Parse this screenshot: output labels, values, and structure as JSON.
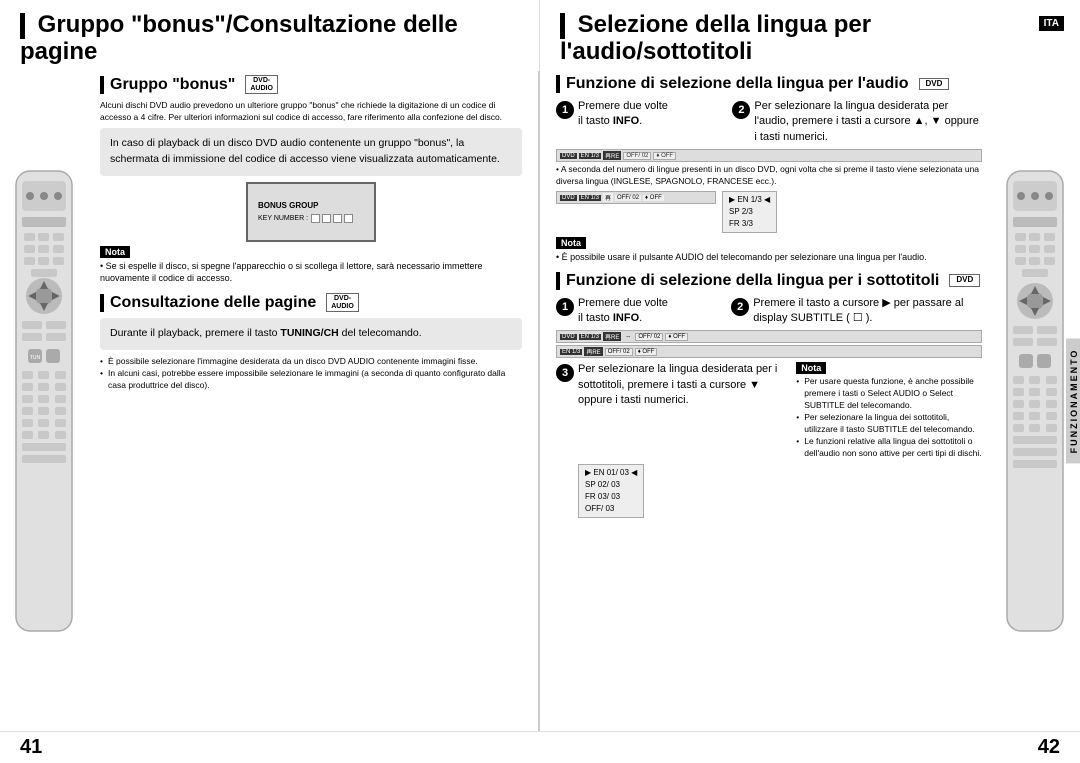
{
  "left_header": {
    "title": "Gruppo \"bonus\"/Consultazione delle pagine"
  },
  "right_header": {
    "title": "Selezione della lingua per l'audio/sottotitoli",
    "ita": "ITA"
  },
  "page_numbers": {
    "left": "41",
    "right": "42"
  },
  "left_page": {
    "section1": {
      "title": "Gruppo \"bonus\"",
      "dvd_label": "DVD-\nAUDIO",
      "intro_text": "Alcuni dischi DVD audio prevedono un ulteriore gruppo \"bonus\" che richiede la digitazione di un codice di accesso a 4 cifre. Per ulteriori informazioni sul codice di accesso, fare riferimento alla confezione del disco.",
      "gray_box": "In caso di playback di un disco DVD audio contenente un gruppo \"bonus\", la schermata di immissione del codice di accesso viene visualizzata automaticamente.",
      "screen": {
        "line1": "BONUS GROUP",
        "line2": "KEY NUMBER :"
      },
      "nota_label": "Nota",
      "nota_text": "• Se si espelle il disco, si spegne l'apparecchio o si scollega il lettore, sarà necessario immettere nuovamente il codice di accesso."
    },
    "section2": {
      "title": "Consultazione delle pagine",
      "dvd_label": "DVD-\nAUDIO",
      "gray_box": "Durante il playback, premere il tasto TUNING/CH del telecomando.",
      "gray_box_bold": "TUNING/CH",
      "bullets": [
        "È possibile selezionare l'immagine desiderata da un disco DVD AUDIO contenente immagini fisse.",
        "In alcuni casi, potrebbe essere impossibile selezionare le immagini (a seconda di quanto configurato dalla casa produttrice del disco)."
      ]
    }
  },
  "right_page": {
    "section1": {
      "title": "Funzione di selezione della lingua per l'audio",
      "dvd_label": "DVD",
      "step1": {
        "num": "1",
        "text": "Premere due volte il tasto INFO."
      },
      "step2": {
        "num": "2",
        "text": "Per selezionare la lingua desiderata per l'audio, premere i tasti a cursore ▲, ▼ oppure i tasti numerici."
      },
      "info_text": "• A seconda del numero di lingue presenti in un disco DVD, ogni volta che si preme il tasto viene selezionata una diversa lingua (INGLESE, SPAGNOLO, FRANCESE ecc.).",
      "lang_list": "EN 1/3\nSP 2/3\nFR 3/3",
      "nota_label": "Nota",
      "nota_text": "• È possibile usare il pulsante AUDIO del telecomando per selezionare una lingua per l'audio."
    },
    "section2": {
      "title": "Funzione di selezione della lingua per i sottotitoli",
      "dvd_label": "DVD",
      "step1": {
        "num": "1",
        "text": "Premere due volte il tasto INFO."
      },
      "step2": {
        "num": "2",
        "text": "Premere il tasto a cursore ▶ per passare al display SUBTITLE ( ☐ )."
      },
      "step3": {
        "num": "3",
        "text": "Per selezionare la lingua desiderata per i sottotitoli, premere i tasti a cursore ▼ oppure i tasti numerici."
      },
      "lang_list2": "EN 01/03\nSP 02/03\nFR 03/03\nOFF/03",
      "nota_label": "Nota",
      "nota_bullets": [
        "Per usare questa funzione, è anche possibile premere i tasti o Select AUDIO o Select SUBTITLE del telecomando.",
        "Per selezionare la lingua dei sottotitoli, utilizzare il tasto SUBTITLE del telecomando.",
        "Le funzioni relative alla lingua dei sottotitoli o dell'audio non sono attive per certi tipi di dischi."
      ]
    }
  },
  "funzionamento": "FUNZIONAMENTO"
}
